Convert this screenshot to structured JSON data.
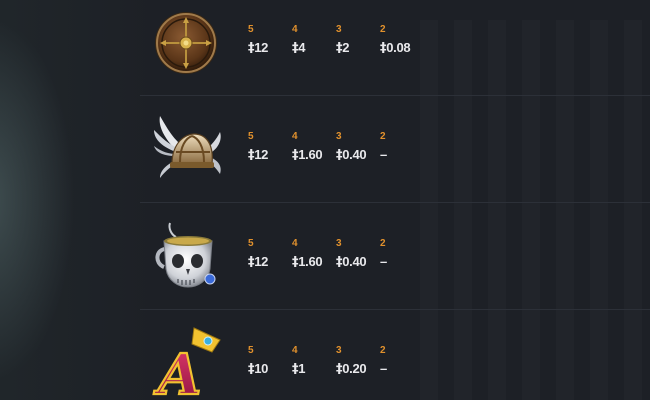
{
  "paytable": {
    "currency_symbol": "‡",
    "rows": [
      {
        "symbol_icon": "shield-icon",
        "counts": [
          "5",
          "4",
          "3",
          "2"
        ],
        "payouts": [
          "12",
          "4",
          "2",
          "0.08"
        ]
      },
      {
        "symbol_icon": "winged-helmet-icon",
        "counts": [
          "5",
          "4",
          "3",
          "2"
        ],
        "payouts": [
          "12",
          "1.60",
          "0.40",
          "–"
        ]
      },
      {
        "symbol_icon": "skull-cup-icon",
        "counts": [
          "5",
          "4",
          "3",
          "2"
        ],
        "payouts": [
          "12",
          "1.60",
          "0.40",
          "–"
        ]
      },
      {
        "symbol_icon": "letter-a-crown-icon",
        "symbol_letter": "A",
        "counts": [
          "5",
          "4",
          "3",
          "2"
        ],
        "payouts": [
          "10",
          "1",
          "0.20",
          "–"
        ]
      }
    ]
  },
  "colors": {
    "background": "#1d2026",
    "count_orange": "#e1912d",
    "payout_white": "#e9e9ec",
    "divider": "#2c3038"
  }
}
